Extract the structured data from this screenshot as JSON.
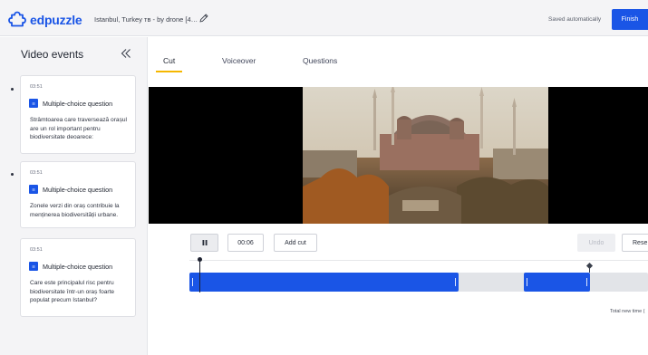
{
  "app": {
    "logo_text": "edpuzzle",
    "video_title": "Istanbul, Turkey тв - by drone [4…",
    "saved_status": "Saved automatically",
    "finish_label": "Finish"
  },
  "sidebar": {
    "title": "Video events",
    "events": [
      {
        "time": "03:51",
        "type_label": "Multiple-choice question",
        "text": "Strâmtoarea care traversează orașul are un rol important pentru biodiversitate deoarece:"
      },
      {
        "time": "03:51",
        "type_label": "Multiple-choice question",
        "text": "Zonele verzi din oraș contribuie la menținerea biodiversității urbane."
      },
      {
        "time": "03:51",
        "type_label": "Multiple-choice question",
        "text": "Care este principalul risc pentru biodiversitate într-un oraș foarte populat precum Istanbul?"
      }
    ]
  },
  "tabs": [
    {
      "label": "Cut",
      "active": true
    },
    {
      "label": "Voiceover",
      "active": false
    },
    {
      "label": "Questions",
      "active": false
    }
  ],
  "controls": {
    "time_value": "00:06",
    "add_cut_label": "Add cut",
    "undo_label": "Undo",
    "reset_label": "Rese"
  },
  "timeline": {
    "total_label": "Total new time ("
  },
  "colors": {
    "brand_blue": "#1a55e6",
    "tab_accent": "#f5b700",
    "sidebar_bg": "#f4f4f6"
  },
  "icons": {
    "logo": "edpuzzle-logo-icon",
    "edit": "pencil-icon",
    "collapse": "double-chevron-left-icon",
    "question": "multiple-choice-icon",
    "pause": "pause-icon"
  }
}
